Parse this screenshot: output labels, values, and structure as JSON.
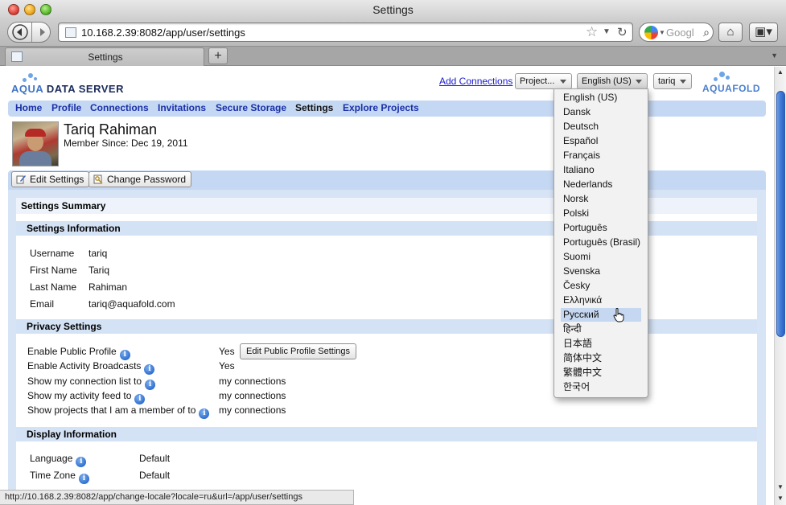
{
  "window": {
    "title": "Settings"
  },
  "browser": {
    "url": "10.168.2.39:8082/app/user/settings",
    "search_placeholder": "Googl",
    "tab_label": "Settings",
    "new_tab": "+",
    "status_url": "http://10.168.2.39:8082/app/change-locale?locale=ru&url=/app/user/settings"
  },
  "header": {
    "logo_left": {
      "aqua": "AQUA",
      "rest": "DATA SERVER"
    },
    "add_connections": "Add Connections",
    "project_select": "Project...",
    "language_select": "English (US)",
    "user_select": "tariq",
    "logo_right": "AQUAFOLD"
  },
  "nav": [
    {
      "label": "Home",
      "active": false
    },
    {
      "label": "Profile",
      "active": false
    },
    {
      "label": "Connections",
      "active": false
    },
    {
      "label": "Invitations",
      "active": false
    },
    {
      "label": "Secure Storage",
      "active": false
    },
    {
      "label": "Settings",
      "active": true
    },
    {
      "label": "Explore Projects",
      "active": false
    }
  ],
  "profile": {
    "name": "Tariq Rahiman",
    "member_since": "Member Since: Dec 19, 2011"
  },
  "actions": {
    "edit": "Edit Settings",
    "password": "Change Password"
  },
  "summary": {
    "title": "Settings Summary",
    "info_title": "Settings Information",
    "info": [
      {
        "label": "Username",
        "value": "tariq"
      },
      {
        "label": "First Name",
        "value": "Tariq"
      },
      {
        "label": "Last Name",
        "value": "Rahiman"
      },
      {
        "label": "Email",
        "value": "tariq@aquafold.com"
      }
    ],
    "privacy_title": "Privacy Settings",
    "privacy": [
      {
        "label": "Enable Public Profile",
        "value": "Yes"
      },
      {
        "label": "Enable Activity Broadcasts",
        "value": "Yes"
      },
      {
        "label": "Show my connection list to",
        "value": "my connections"
      },
      {
        "label": "Show my activity feed to",
        "value": "my connections"
      },
      {
        "label": "Show projects that I am a member of to",
        "value": "my connections"
      }
    ],
    "public_profile_button": "Edit Public Profile Settings",
    "display_title": "Display Information",
    "display": [
      {
        "label": "Language",
        "value": "Default"
      },
      {
        "label": "Time Zone",
        "value": "Default"
      }
    ]
  },
  "language_menu": {
    "highlighted": "Русский",
    "options": [
      "English (US)",
      "Dansk",
      "Deutsch",
      "Español",
      "Français",
      "Italiano",
      "Nederlands",
      "Norsk",
      "Polski",
      "Português",
      "Português (Brasil)",
      "Suomi",
      "Svenska",
      "Česky",
      "Ελληνικά",
      "Русский",
      "हिन्दी",
      "日本語",
      "简体中文",
      "繁體中文",
      "한국어"
    ]
  },
  "colors": {
    "link": "#1a1acc",
    "nav_bg": "#c5d8f3",
    "section_bg": "#d4e2f5",
    "accent": "#3f79d6"
  }
}
